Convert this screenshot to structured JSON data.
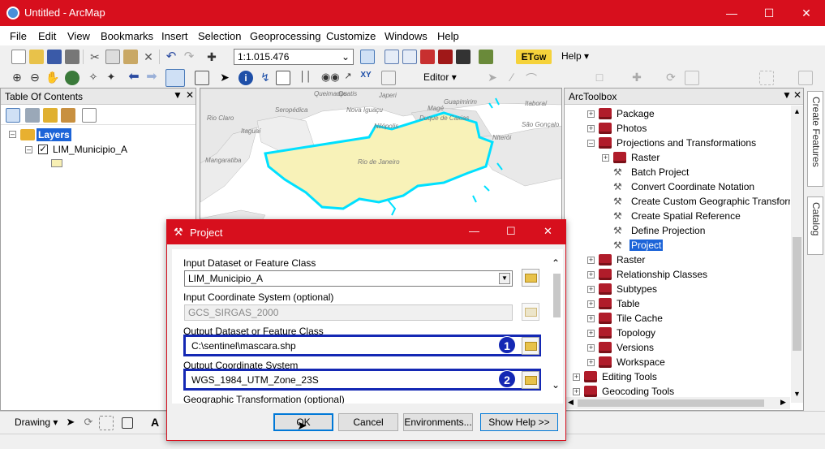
{
  "window": {
    "title": "Untitled - ArcMap"
  },
  "menu": [
    "File",
    "Edit",
    "View",
    "Bookmarks",
    "Insert",
    "Selection",
    "Geoprocessing",
    "Customize",
    "Windows",
    "Help"
  ],
  "toolbar": {
    "scale": "1:1.015.476",
    "help_label": "Help",
    "editor_label": "Editor"
  },
  "toc": {
    "title": "Table Of Contents",
    "layers_label": "Layers",
    "layer_name": "LIM_Municipio_A"
  },
  "map": {
    "labels": [
      "Quatis",
      "Queimados",
      "Japeri",
      "Guapimirim",
      "Magé",
      "Itaboraí",
      "Rio Claro",
      "Seropédica",
      "Nova Iguaçu",
      "Duque de Caxias",
      "São Gonçalo",
      "Itaguaí",
      "Nilópolis",
      "Niterói",
      "Mangaratiba",
      "Rio de Janeiro"
    ]
  },
  "arctoolbox": {
    "title": "ArcToolbox",
    "items": [
      {
        "label": "Package",
        "kind": "toolbox"
      },
      {
        "label": "Photos",
        "kind": "toolbox"
      },
      {
        "label": "Projections and Transformations",
        "kind": "toolbox"
      },
      {
        "label": "Raster",
        "kind": "toolbox"
      },
      {
        "label": "Batch Project",
        "kind": "tool"
      },
      {
        "label": "Convert Coordinate Notation",
        "kind": "tool"
      },
      {
        "label": "Create Custom Geographic Transform",
        "kind": "tool"
      },
      {
        "label": "Create Spatial Reference",
        "kind": "tool"
      },
      {
        "label": "Define Projection",
        "kind": "tool"
      },
      {
        "label": "Project",
        "kind": "tool"
      },
      {
        "label": "Raster",
        "kind": "toolbox"
      },
      {
        "label": "Relationship Classes",
        "kind": "toolbox"
      },
      {
        "label": "Subtypes",
        "kind": "toolbox"
      },
      {
        "label": "Table",
        "kind": "toolbox"
      },
      {
        "label": "Tile Cache",
        "kind": "toolbox"
      },
      {
        "label": "Topology",
        "kind": "toolbox"
      },
      {
        "label": "Versions",
        "kind": "toolbox"
      },
      {
        "label": "Workspace",
        "kind": "toolbox"
      },
      {
        "label": "Editing Tools",
        "kind": "toolbox"
      },
      {
        "label": "Geocoding Tools",
        "kind": "toolbox"
      }
    ]
  },
  "side_tabs": [
    "Create Features",
    "Catalog"
  ],
  "drawing": {
    "label": "Drawing"
  },
  "dialog": {
    "title": "Project",
    "input_dataset_label": "Input Dataset or Feature Class",
    "input_dataset_value": "LIM_Municipio_A",
    "input_cs_label": "Input Coordinate System (optional)",
    "input_cs_value": "GCS_SIRGAS_2000",
    "output_dataset_label": "Output Dataset or Feature Class",
    "output_dataset_value": "C:\\sentinel\\mascara.shp",
    "output_cs_label": "Output Coordinate System",
    "output_cs_value": "WGS_1984_UTM_Zone_23S",
    "geo_transform_label": "Geographic Transformation (optional)",
    "badge1": "1",
    "badge2": "2",
    "ok": "OK",
    "cancel": "Cancel",
    "environments": "Environments...",
    "show_help": "Show Help >>"
  }
}
